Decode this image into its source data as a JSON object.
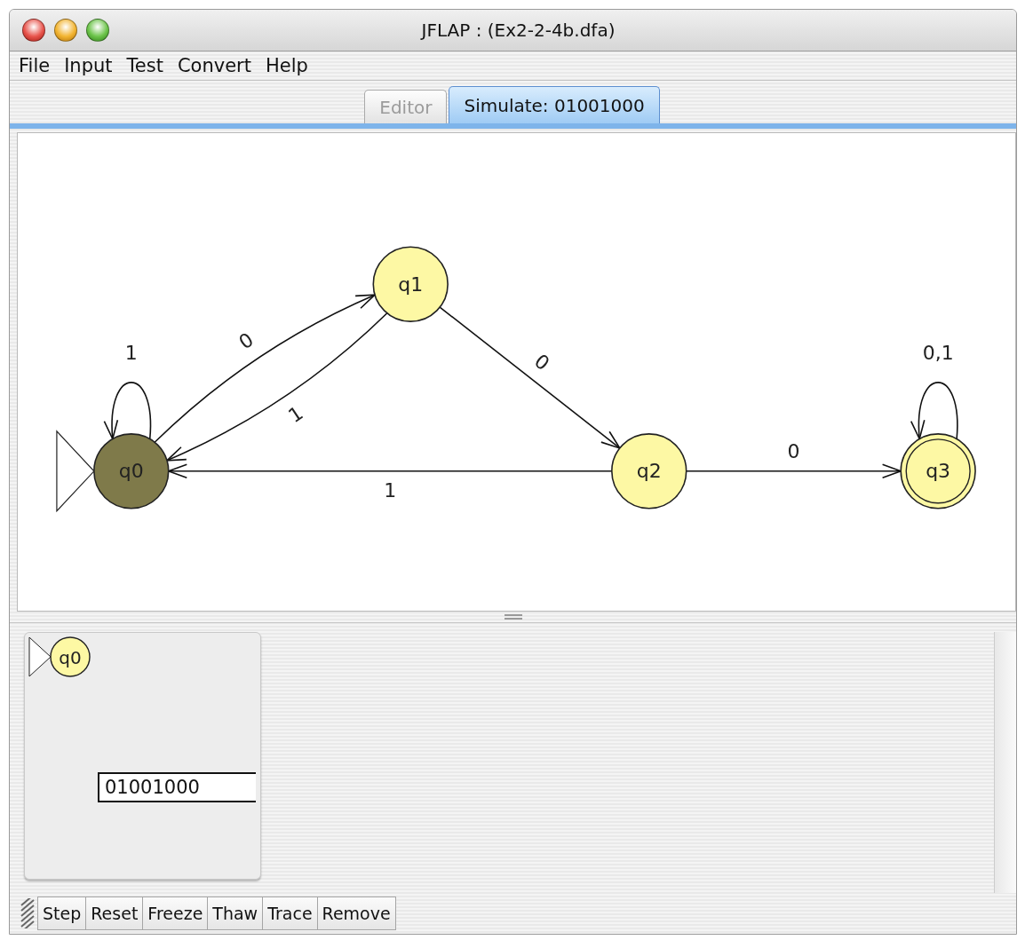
{
  "window": {
    "title": "JFLAP : (Ex2-2-4b.dfa)"
  },
  "menu": [
    "File",
    "Input",
    "Test",
    "Convert",
    "Help"
  ],
  "tabs": [
    {
      "label": "Editor",
      "selected": false,
      "disabled": true
    },
    {
      "label": "Simulate: 01001000",
      "selected": true,
      "disabled": false
    }
  ],
  "automaton": {
    "states": [
      {
        "label": "q0",
        "initial": true,
        "final": false,
        "active": true
      },
      {
        "label": "q1",
        "initial": false,
        "final": false,
        "active": false
      },
      {
        "label": "q2",
        "initial": false,
        "final": false,
        "active": false
      },
      {
        "label": "q3",
        "initial": false,
        "final": true,
        "active": false
      }
    ],
    "transitions": [
      {
        "label": "1"
      },
      {
        "label": "0"
      },
      {
        "label": "1"
      },
      {
        "label": "0"
      },
      {
        "label": "1"
      },
      {
        "label": "0"
      },
      {
        "label": "0,1"
      }
    ]
  },
  "configurations": [
    {
      "state": "q0",
      "initial": true,
      "input": "01001000"
    }
  ],
  "buttons": [
    "Step",
    "Reset",
    "Freeze",
    "Thaw",
    "Trace",
    "Remove"
  ]
}
